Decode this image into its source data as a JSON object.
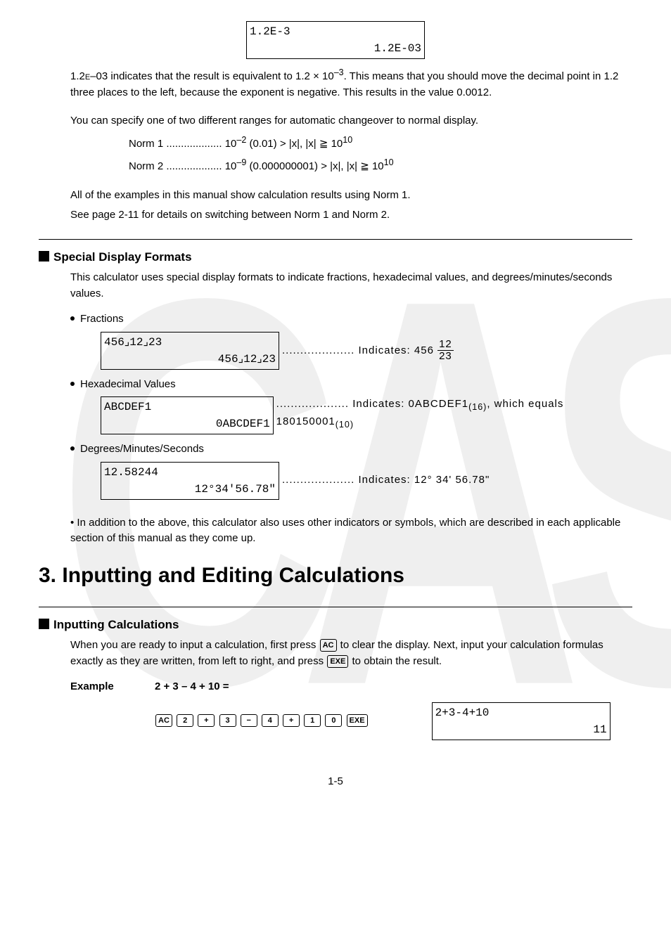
{
  "lcd1": {
    "top": "1.2E-3",
    "bot": "1.2E-03"
  },
  "p1a": "1.2",
  "p1b": "E",
  "p1c": "–03 indicates that the result is equivalent to 1.2 × 10",
  "p1sup": "–3",
  "p1d": ". This means that you should move the decimal point in 1.2 three places to the left, because the exponent is negative. This results in the value 0.0012.",
  "p2": "You can specify one of two different ranges for automatic changeover to normal display.",
  "norm1a": "Norm 1 ................... 10",
  "norm1b": " (0.01) > |x|, |x| ≧ 10",
  "norm1e1": "–2",
  "norm1e2": "10",
  "norm2a": "Norm 2 ................... 10",
  "norm2b": " (0.000000001) > |x|, |x| ≧ 10",
  "norm2e1": "–9",
  "norm2e2": "10",
  "p3": "All of the examples in this manual show calculation results using Norm 1.",
  "p4": "See page 2-11 for details on switching between Norm 1 and Norm 2.",
  "s1": "Special Display Formats",
  "p5": "This calculator uses special display formats to indicate fractions, hexadecimal values, and degrees/minutes/seconds values.",
  "frtitle": "Fractions",
  "lcd2": {
    "top": "456⌟12⌟23",
    "bot": "456⌟12⌟23"
  },
  "frind": ".................... Indicates: 456",
  "frnum": "12",
  "frden": "23",
  "hextitle": "Hexadecimal Values",
  "lcd3": {
    "top": "ABCDEF1",
    "bot": "0ABCDEF1"
  },
  "hexind": ".................... Indicates: 0ABCDEF1",
  "hexsub1": "(16)",
  "hexind2": ", which equals 180150001",
  "hexsub2": "(10)",
  "dmstitle": "Degrees/Minutes/Seconds",
  "lcd4": {
    "top": "12.58244",
    "bot": "12°34'56.78\""
  },
  "dmsind": ".................... Indicates: 12° 34' 56.78\"",
  "p6": "In addition to the above, this calculator also uses other indicators or symbols, which are described in each applicable section of this manual as they come up.",
  "h1": "3. Inputting and Editing Calculations",
  "s2": "Inputting Calculations",
  "p7a": "When you are ready to input a calculation, first press ",
  "p7b": " to clear the display. Next, input your calculation formulas exactly as they are written, from left to right, and press ",
  "p7c": " to obtain the result.",
  "exlabel": "Example",
  "exeq": "2 + 3 – 4 + 10 =",
  "keys": [
    "AC",
    "2",
    "+",
    "3",
    "−",
    "4",
    "+",
    "1",
    "0",
    "EXE"
  ],
  "lcd5": {
    "top": "2+3-4+10",
    "bot": "11"
  },
  "pageno": "1-5",
  "chart_data": null
}
